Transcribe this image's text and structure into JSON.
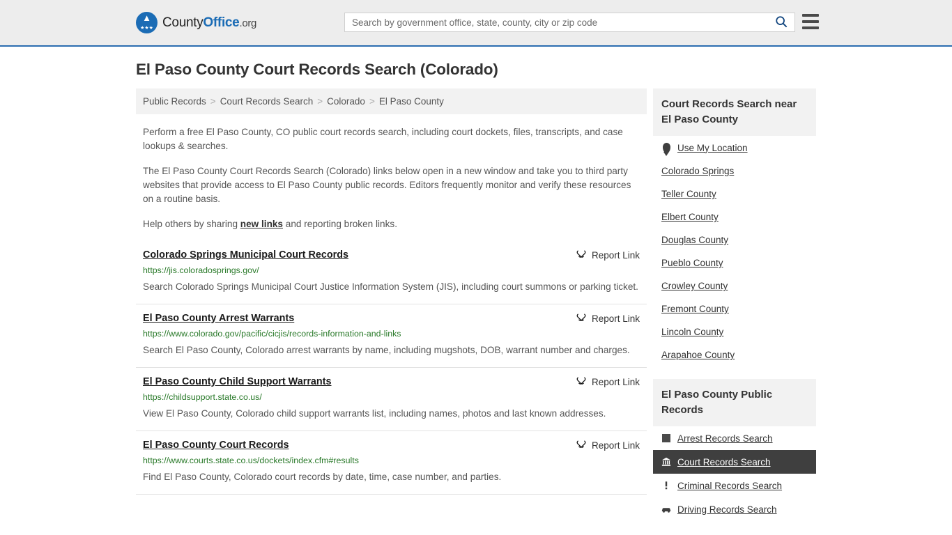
{
  "header": {
    "logo_text_1": "County",
    "logo_text_2": "Office",
    "logo_text_3": ".org",
    "logo_icon": "eagle-seal-icon",
    "search_placeholder": "Search by government office, state, county, city or zip code",
    "search_value": "",
    "search_icon": "search-icon",
    "menu_icon": "hamburger-menu-icon"
  },
  "page": {
    "title": "El Paso County Court Records Search (Colorado)"
  },
  "breadcrumb": {
    "separator": ">",
    "items": [
      {
        "label": "Public Records"
      },
      {
        "label": "Court Records Search"
      },
      {
        "label": "Colorado"
      },
      {
        "label": "El Paso County"
      }
    ]
  },
  "intro": {
    "p1": "Perform a free El Paso County, CO public court records search, including court dockets, files, transcripts, and case lookups & searches.",
    "p2": "The El Paso County Court Records Search (Colorado) links below open in a new window and take you to third party websites that provide access to El Paso County public records. Editors frequently monitor and verify these resources on a routine basis.",
    "p3_before": "Help others by sharing ",
    "p3_link": "new links",
    "p3_after": " and reporting broken links."
  },
  "results": {
    "report_label": "Report Link",
    "report_icon": "broken-link-icon",
    "items": [
      {
        "title": "Colorado Springs Municipal Court Records",
        "url": "https://jis.coloradosprings.gov/",
        "description": "Search Colorado Springs Municipal Court Justice Information System (JIS), including court summons or parking ticket."
      },
      {
        "title": "El Paso County Arrest Warrants",
        "url": "https://www.colorado.gov/pacific/cicjis/records-information-and-links",
        "description": "Search El Paso County, Colorado arrest warrants by name, including mugshots, DOB, warrant number and charges."
      },
      {
        "title": "El Paso County Child Support Warrants",
        "url": "https://childsupport.state.co.us/",
        "description": "View El Paso County, Colorado child support warrants list, including names, photos and last known addresses."
      },
      {
        "title": "El Paso County Court Records",
        "url": "https://www.courts.state.co.us/dockets/index.cfm#results",
        "description": "Find El Paso County, Colorado court records by date, time, case number, and parties."
      }
    ]
  },
  "sidebar": {
    "nearby": {
      "heading": "Court Records Search near El Paso County",
      "use_my_location": "Use My Location",
      "location_icon": "map-pin-icon",
      "places": [
        {
          "label": "Colorado Springs"
        },
        {
          "label": "Teller County"
        },
        {
          "label": "Elbert County"
        },
        {
          "label": "Douglas County"
        },
        {
          "label": "Pueblo County"
        },
        {
          "label": "Crowley County"
        },
        {
          "label": "Fremont County"
        },
        {
          "label": "Lincoln County"
        },
        {
          "label": "Arapahoe County"
        }
      ]
    },
    "public_records": {
      "heading": "El Paso County Public Records",
      "items": [
        {
          "label": "Arrest Records Search",
          "icon": "fingerprint-square-icon",
          "active": false
        },
        {
          "label": "Court Records Search",
          "icon": "courthouse-icon",
          "active": true
        },
        {
          "label": "Criminal Records Search",
          "icon": "exclamation-icon",
          "active": false
        },
        {
          "label": "Driving Records Search",
          "icon": "car-icon",
          "active": false
        }
      ]
    }
  },
  "colors": {
    "accent_blue": "#1b6cb5",
    "header_bg": "#ededed",
    "link_green": "#2a7a2a",
    "active_bg": "#3f3f3f"
  }
}
